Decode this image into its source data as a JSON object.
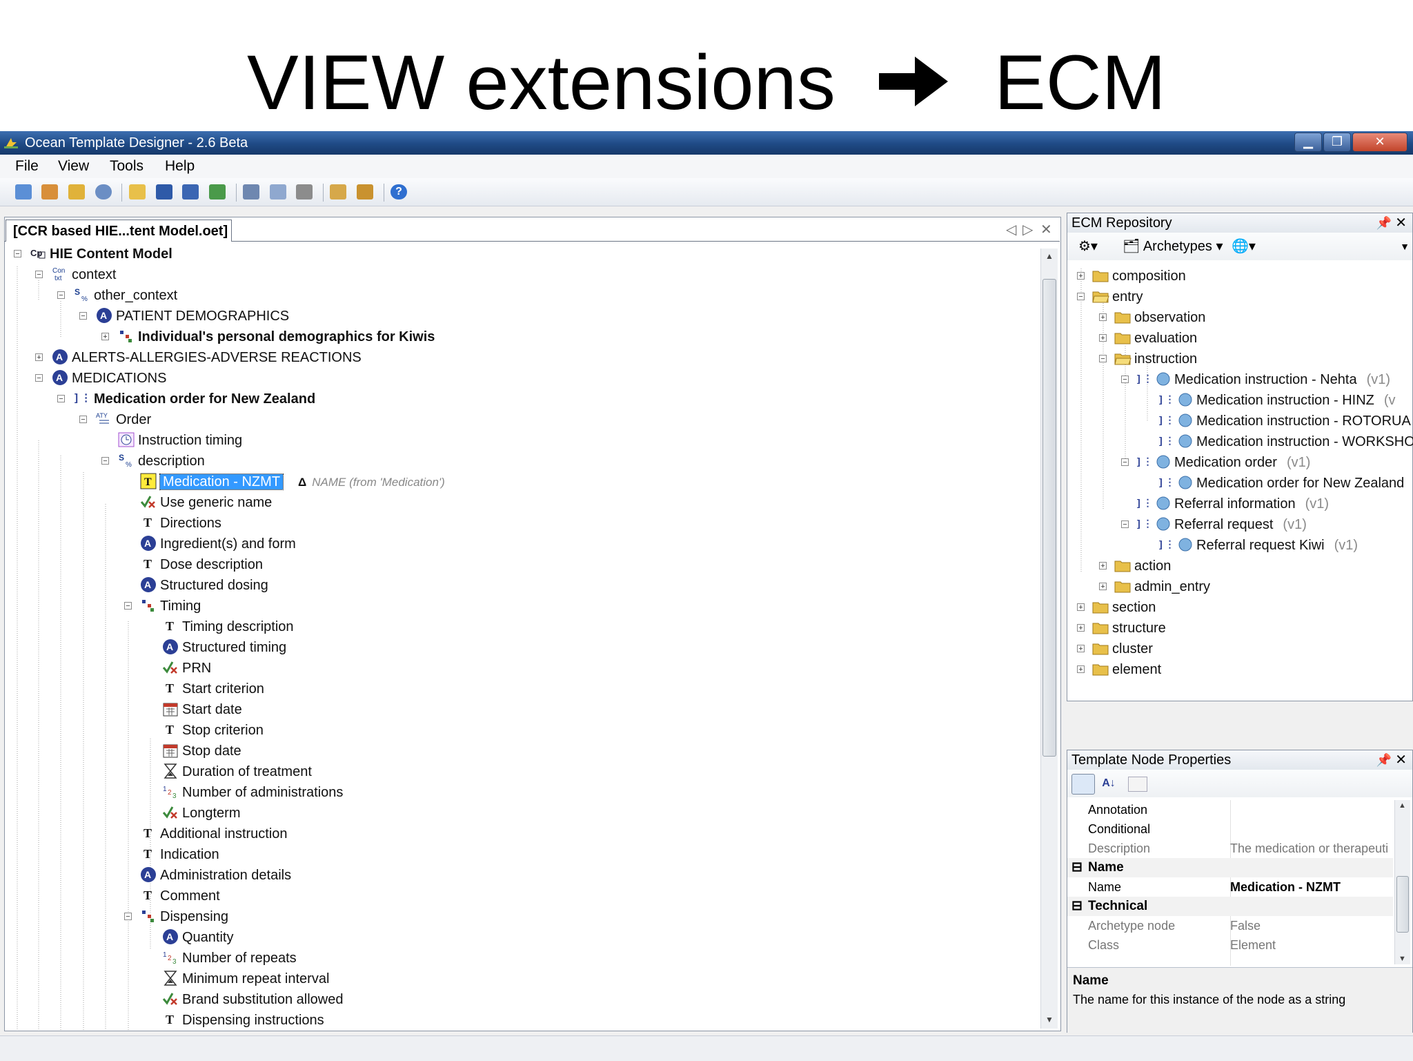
{
  "slide": {
    "title_left": "VIEW extensions",
    "title_right": "ECM"
  },
  "window": {
    "title": "Ocean Template Designer - 2.6 Beta"
  },
  "menu": [
    "File",
    "View",
    "Tools",
    "Help"
  ],
  "doc": {
    "tab_label": "[CCR based HIE...tent Model.oet]",
    "tree": [
      {
        "label": "HIE Content Model",
        "bold": true
      },
      {
        "label": "context"
      },
      {
        "label": "other_context"
      },
      {
        "label": "PATIENT DEMOGRAPHICS"
      },
      {
        "label": "Individual's personal demographics for Kiwis",
        "bold": true
      },
      {
        "label": "ALERTS-ALLERGIES-ADVERSE REACTIONS"
      },
      {
        "label": "MEDICATIONS"
      },
      {
        "label": "Medication order for New Zealand",
        "bold": true
      },
      {
        "label": "Order"
      },
      {
        "label": "Instruction timing"
      },
      {
        "label": "description"
      },
      {
        "label": "Medication - NZMT",
        "selected": true
      },
      {
        "label": "Use generic name"
      },
      {
        "label": "Directions"
      },
      {
        "label": "Ingredient(s) and form"
      },
      {
        "label": "Dose description"
      },
      {
        "label": "Structured dosing"
      },
      {
        "label": "Timing"
      },
      {
        "label": "Timing description"
      },
      {
        "label": "Structured timing"
      },
      {
        "label": "PRN"
      },
      {
        "label": "Start criterion"
      },
      {
        "label": "Start date"
      },
      {
        "label": "Stop criterion"
      },
      {
        "label": "Stop date"
      },
      {
        "label": "Duration of treatment"
      },
      {
        "label": "Number of administrations"
      },
      {
        "label": "Longterm"
      },
      {
        "label": "Additional instruction"
      },
      {
        "label": "Indication"
      },
      {
        "label": "Administration details"
      },
      {
        "label": "Comment"
      },
      {
        "label": "Dispensing"
      },
      {
        "label": "Quantity"
      },
      {
        "label": "Number of repeats"
      },
      {
        "label": "Minimum repeat interval"
      },
      {
        "label": "Brand substitution allowed"
      },
      {
        "label": "Dispensing instructions"
      }
    ],
    "selected_note": {
      "symbol": "Δ",
      "text": "NAME (from 'Medication')"
    }
  },
  "repo": {
    "title": "ECM Repository",
    "filter": "Archetypes",
    "tree": [
      {
        "label": "composition"
      },
      {
        "label": "entry"
      },
      {
        "label": "observation"
      },
      {
        "label": "evaluation"
      },
      {
        "label": "instruction"
      },
      {
        "label": "Medication instruction - Nehta",
        "version": "(v1)"
      },
      {
        "label": "Medication instruction - HINZ",
        "version": "(v"
      },
      {
        "label": "Medication instruction - ROTORUA",
        "version": ""
      },
      {
        "label": "Medication instruction - WORKSHO",
        "version": ""
      },
      {
        "label": "Medication order",
        "version": "(v1)"
      },
      {
        "label": "Medication order for New Zealand",
        "version": ""
      },
      {
        "label": "Referral information",
        "version": "(v1)"
      },
      {
        "label": "Referral request",
        "version": "(v1)"
      },
      {
        "label": "Referral request Kiwi",
        "version": "(v1)"
      },
      {
        "label": "action"
      },
      {
        "label": "admin_entry"
      },
      {
        "label": "section"
      },
      {
        "label": "structure"
      },
      {
        "label": "cluster"
      },
      {
        "label": "element"
      }
    ]
  },
  "props": {
    "title": "Template Node Properties",
    "rows": [
      {
        "key": "Annotation",
        "value": ""
      },
      {
        "key": "Conditional",
        "value": ""
      },
      {
        "key": "Description",
        "value": "The medication or therapeuti"
      }
    ],
    "section_name": "Name",
    "name_row": {
      "key": "Name",
      "value": "Medication - NZMT"
    },
    "section_technical": "Technical",
    "tech_rows": [
      {
        "key": "Archetype node",
        "value": "False"
      },
      {
        "key": "Class",
        "value": "Element"
      }
    ],
    "help_title": "Name",
    "help_text": "The name for this instance of the node as a string"
  },
  "colors": {
    "selection": "#3399ff",
    "titlebar": "#1f4a85",
    "folder": "#e8c04a"
  }
}
